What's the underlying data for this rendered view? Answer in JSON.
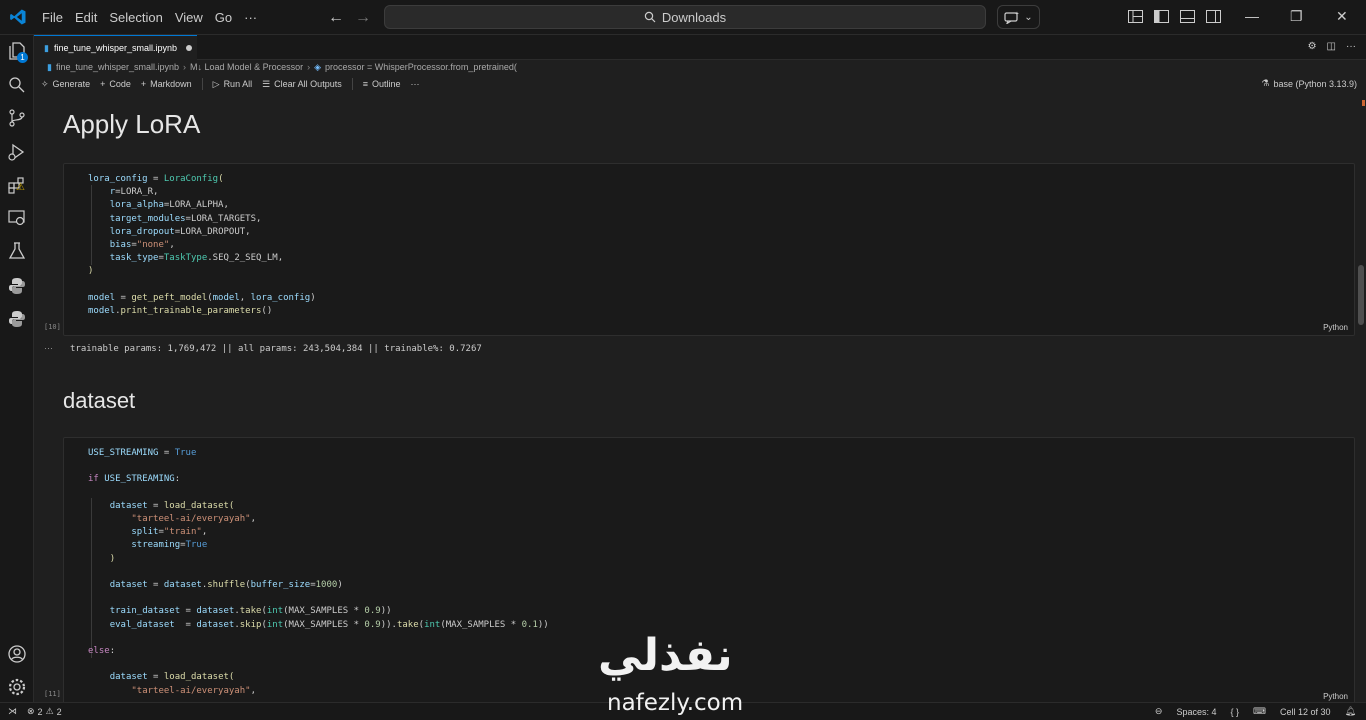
{
  "menu": [
    "File",
    "Edit",
    "Selection",
    "View",
    "Go",
    "···"
  ],
  "search": {
    "label": "Downloads"
  },
  "tab": {
    "label": "fine_tune_whisper_small.ipynb"
  },
  "breadcrumb": {
    "file": "fine_tune_whisper_small.ipynb",
    "section": "M↓ Load Model & Processor",
    "symbol": "processor = WhisperProcessor.from_pretrained("
  },
  "toolbar": {
    "generate": "Generate",
    "code": "Code",
    "markdown": "Markdown",
    "run_all": "Run All",
    "clear_outputs": "Clear All Outputs",
    "outline": "Outline",
    "more": "···",
    "kernel": "base (Python 3.13.9)"
  },
  "notebook": {
    "heading1": "Apply LoRA",
    "cell1": {
      "exec_count": "[10]",
      "language": "Python",
      "output": "trainable params: 1,769,472 || all params: 243,504,384 || trainable%: 0.7267",
      "output_dots": "···"
    },
    "heading2": "dataset",
    "cell2": {
      "exec_count": "[11]",
      "language": "Python"
    }
  },
  "watermark": {
    "arabic": "نفذلي",
    "latin": "nafezly.com"
  },
  "status": {
    "errors": "2",
    "warnings": "2",
    "spaces": "Spaces: 4",
    "braces": "{ }",
    "cell": "Cell 12 of 30"
  },
  "colors": {
    "accent": "#0078d4",
    "background": "#1f1f1f",
    "chrome": "#181818"
  }
}
